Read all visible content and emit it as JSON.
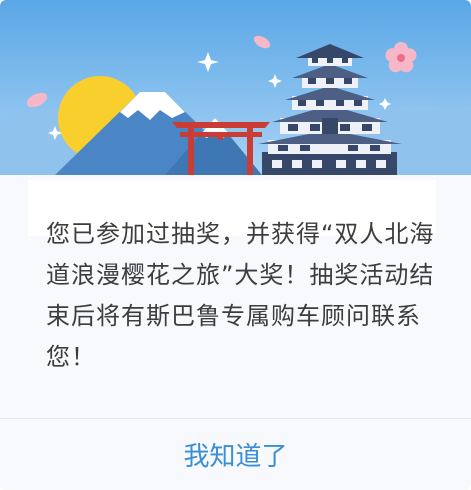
{
  "dialog": {
    "message": "您已参加过抽奖，并获得“双人北海道浪漫樱花之旅”大奖！抽奖活动结束后将有斯巴鲁专属购车顾问联系您！",
    "confirm_label": "我知道了"
  },
  "colors": {
    "sky_top": "#5aa7e6",
    "sky_bottom": "#cfe6f8",
    "accent_blue": "#3a8ed6",
    "torii_red": "#c93d35",
    "sun_yellow": "#f9cf2d",
    "sakura_pink": "#f6b8c8"
  },
  "icons": [
    "mount-fuji-icon",
    "sun-icon",
    "torii-gate-icon",
    "japanese-castle-icon",
    "cherry-blossom-icon",
    "sparkle-icon"
  ]
}
